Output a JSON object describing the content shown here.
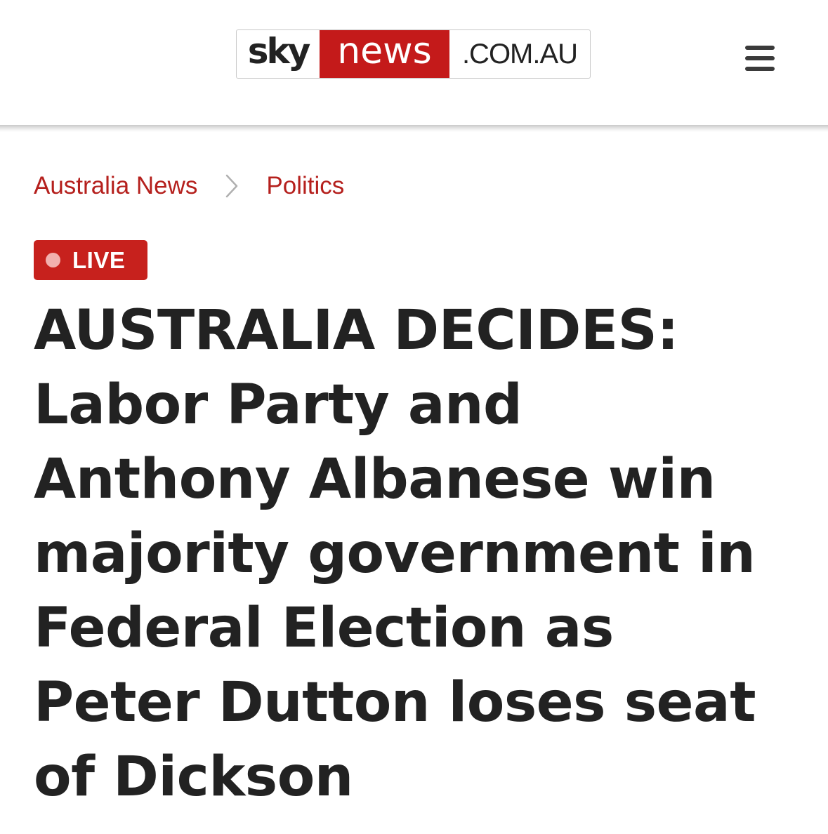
{
  "header": {
    "logo": {
      "sky": "sky",
      "news": "news",
      "domain": ".COM.AU"
    },
    "menu_icon": "hamburger-menu-icon"
  },
  "breadcrumb": {
    "items": [
      {
        "label": "Australia News"
      },
      {
        "label": "Politics"
      }
    ],
    "separator_icon": "chevron-right-icon"
  },
  "live_badge": {
    "label": "LIVE"
  },
  "headline": {
    "lines": [
      "AUSTRALIA DECIDES:",
      "Labor Party and",
      "Anthony Albanese win",
      "majority government in",
      "Federal Election as",
      "Peter Dutton loses seat",
      "of Dickson"
    ]
  },
  "colors": {
    "brand_red": "#c41a1a",
    "link_red": "#b5201d",
    "live_red": "#c7211d",
    "headline_text": "#222222"
  }
}
